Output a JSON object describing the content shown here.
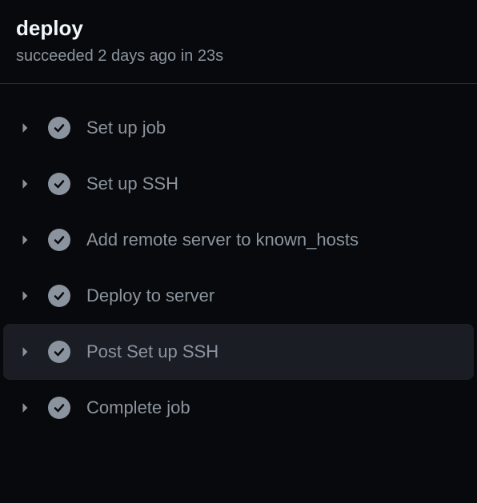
{
  "job": {
    "title": "deploy",
    "status": "succeeded 2 days ago in 23s"
  },
  "steps": [
    {
      "label": "Set up job",
      "hovered": false
    },
    {
      "label": "Set up SSH",
      "hovered": false
    },
    {
      "label": "Add remote server to known_hosts",
      "hovered": false
    },
    {
      "label": "Deploy to server",
      "hovered": false
    },
    {
      "label": "Post Set up SSH",
      "hovered": true
    },
    {
      "label": "Complete job",
      "hovered": false
    }
  ]
}
